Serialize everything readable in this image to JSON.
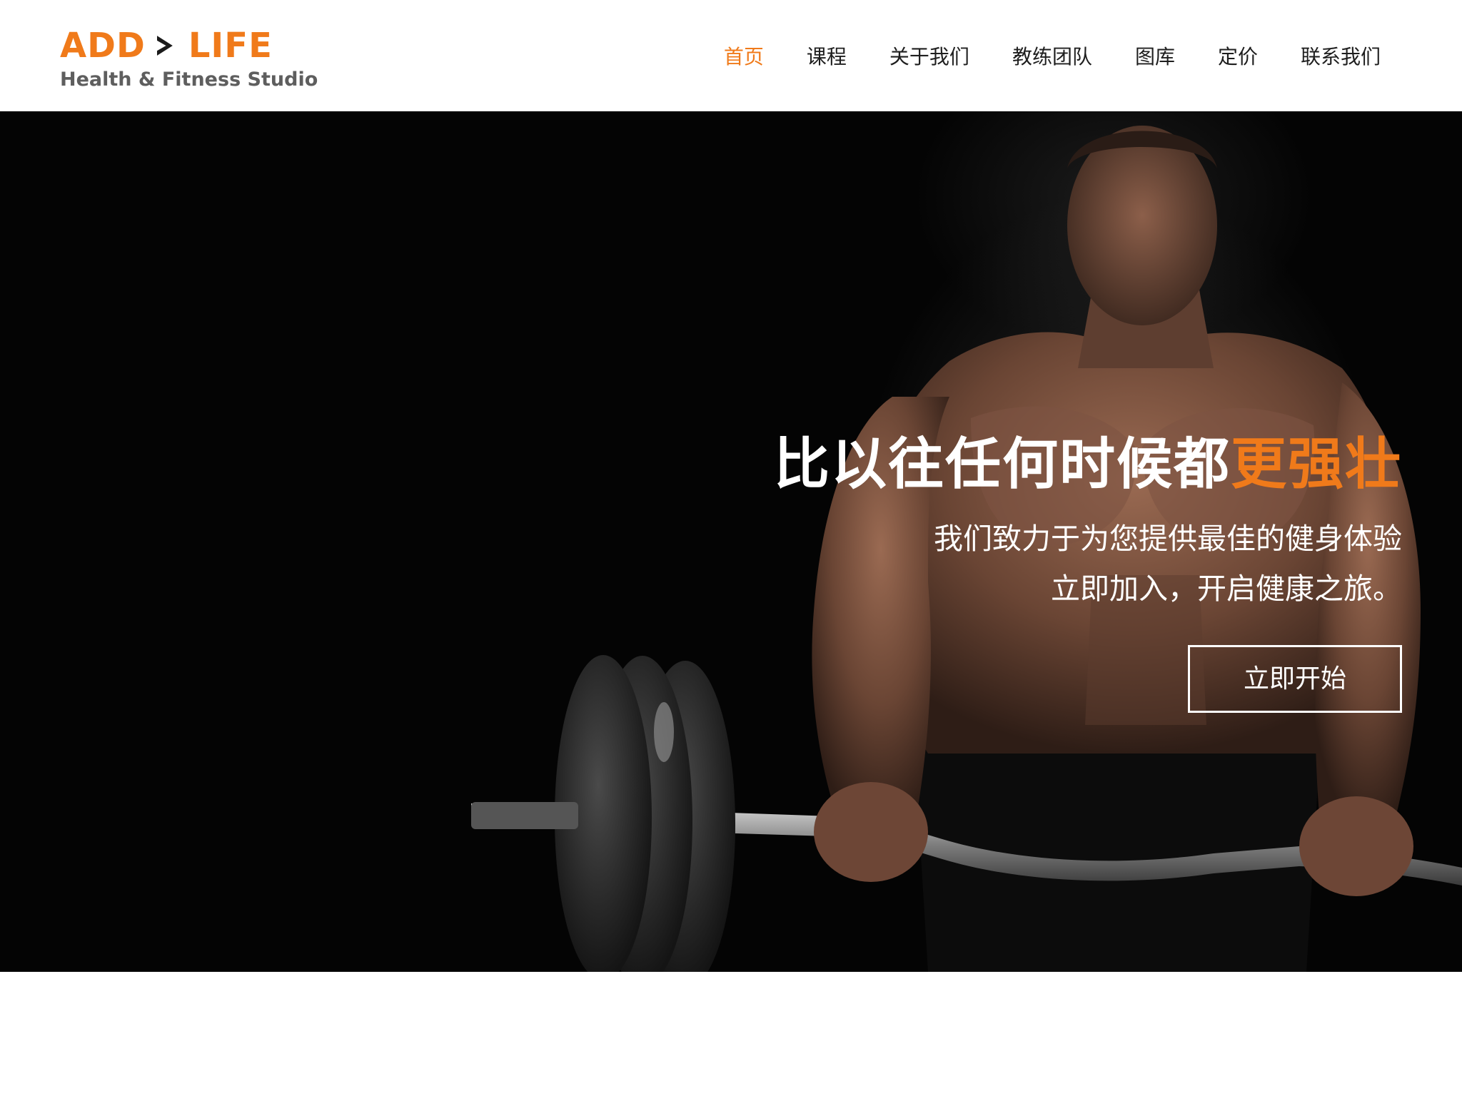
{
  "logo": {
    "brand_left": "ADD",
    "brand_right": "LIFE",
    "tagline": "Health & Fitness Studio",
    "accent_color": "#f07a1a"
  },
  "nav": {
    "items": [
      {
        "label": "首页",
        "active": true
      },
      {
        "label": "课程",
        "active": false
      },
      {
        "label": "关于我们",
        "active": false
      },
      {
        "label": "教练团队",
        "active": false
      },
      {
        "label": "图库",
        "active": false
      },
      {
        "label": "定价",
        "active": false
      },
      {
        "label": "联系我们",
        "active": false
      }
    ]
  },
  "hero": {
    "title_main": "比以往任何时候都",
    "title_accent": "更强壮",
    "subtitle_line1": "我们致力于为您提供最佳的健身体验",
    "subtitle_line2": "立即加入，开启健康之旅。",
    "cta_label": "立即开始",
    "background_color": "#040404"
  }
}
